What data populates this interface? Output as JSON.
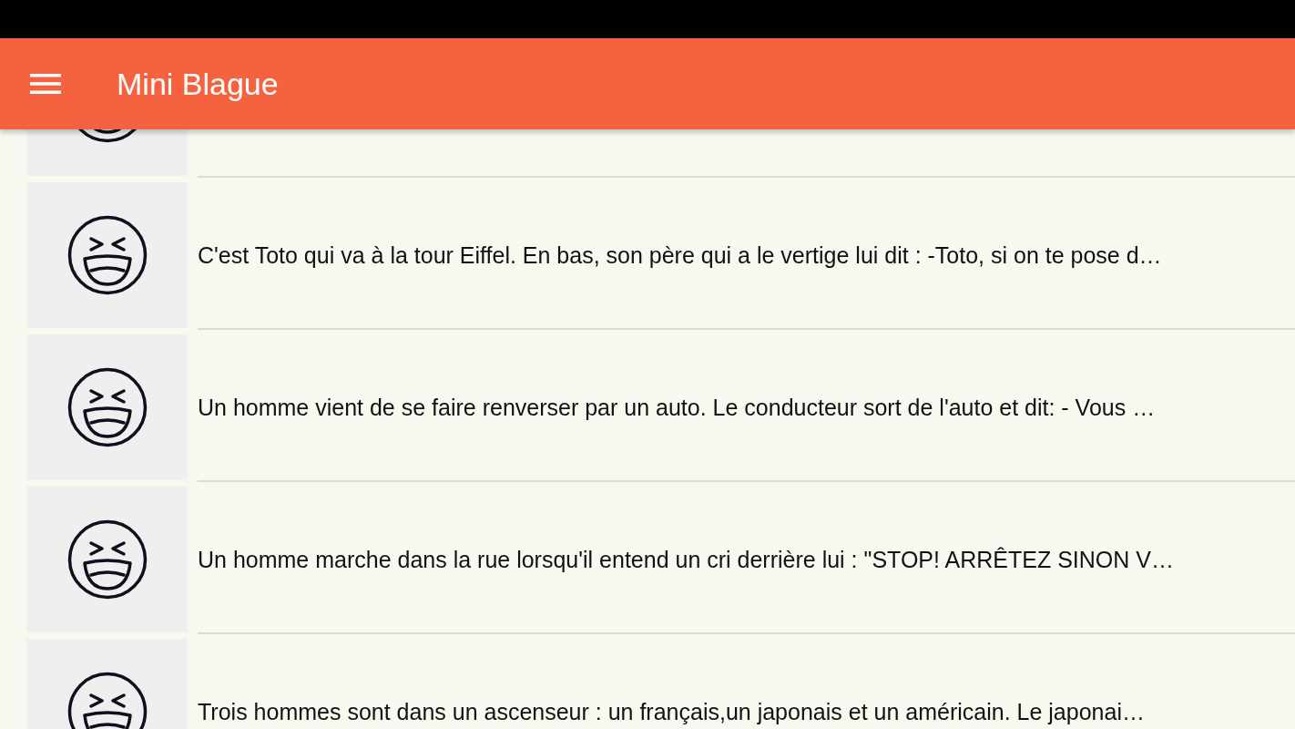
{
  "app_bar": {
    "title": "Mini Blague"
  },
  "jokes": [
    {
      "kind": "partial"
    },
    {
      "kind": "joke",
      "text": "C'est Toto qui va à la tour Eiffel. En bas, son père qui a le vertige lui dit : -Toto, si on te pose d…"
    },
    {
      "kind": "joke",
      "text": "Un homme vient de se faire renverser par un auto. Le conducteur sort de l'auto et dit: - Vous …"
    },
    {
      "kind": "joke",
      "text": "Un homme marche dans la rue lorsqu'il entend un cri derrière lui : \"STOP! ARRÊTEZ SINON V…"
    },
    {
      "kind": "joke",
      "text": "Trois hommes sont dans un ascenseur : un français,un japonais et un américain. Le japonai…"
    }
  ]
}
